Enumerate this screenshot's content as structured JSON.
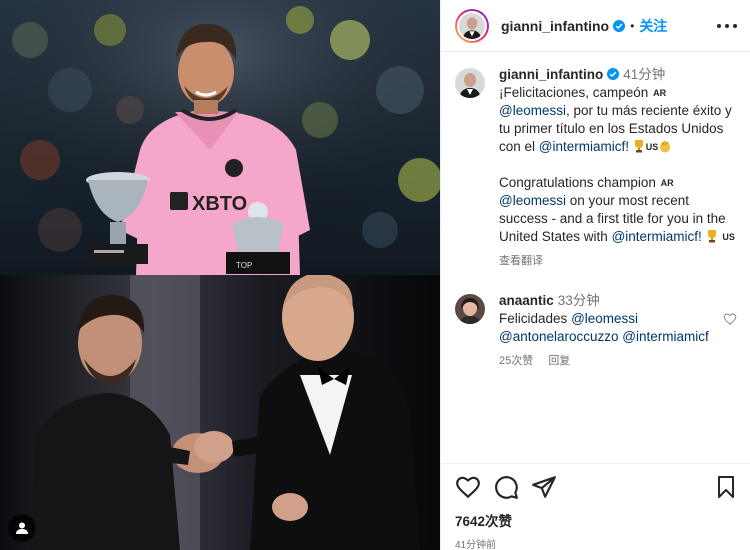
{
  "post": {
    "author": "gianni_infantino",
    "follow_label": "关注",
    "dot": "•"
  },
  "caption": {
    "author": "gianni_infantino",
    "time": "41分钟",
    "es_line_start": "¡Felicitaciones, campeón",
    "flag_ar": "AR",
    "mention_leomessi": "@leomessi",
    "es_line_mid": ", por tu más reciente éxito y tu primer título en los Estados Unidos con el",
    "mention_intermiami_es": "@intermiamicf!",
    "flag_us": "US",
    "en_line_start": "Congratulations champion",
    "en_flag_ar": "AR",
    "en_mention_leomessi": "@leomessi",
    "en_line_mid": " on your most recent success - and a first title for you in the United States with",
    "en_mention_intermiami": "@intermiamicf!",
    "en_flag_us": "US",
    "see_translation": "查看翻译"
  },
  "reply": {
    "author": "anaantic",
    "time": "33分钟",
    "text": "Felicidades",
    "mention_leomessi": "@leomessi",
    "mention_antonela": "@antonelaroccuzzo",
    "mention_intermiami": "@intermiamicf",
    "likes": "25次赞",
    "reply_label": "回复"
  },
  "actions": {
    "likes": "7642次赞",
    "posted": "41分钟前"
  },
  "icons": [
    "verified-icon",
    "more-icon",
    "heart-icon",
    "comment-icon",
    "share-icon",
    "bookmark-icon",
    "user-tag-icon",
    "trophy-icon",
    "clap-icon"
  ],
  "colors": {
    "link": "#00376b",
    "follow": "#0095f6",
    "verified": "#0095f6",
    "muted": "#737373",
    "jersey": "#f4a7c8"
  }
}
